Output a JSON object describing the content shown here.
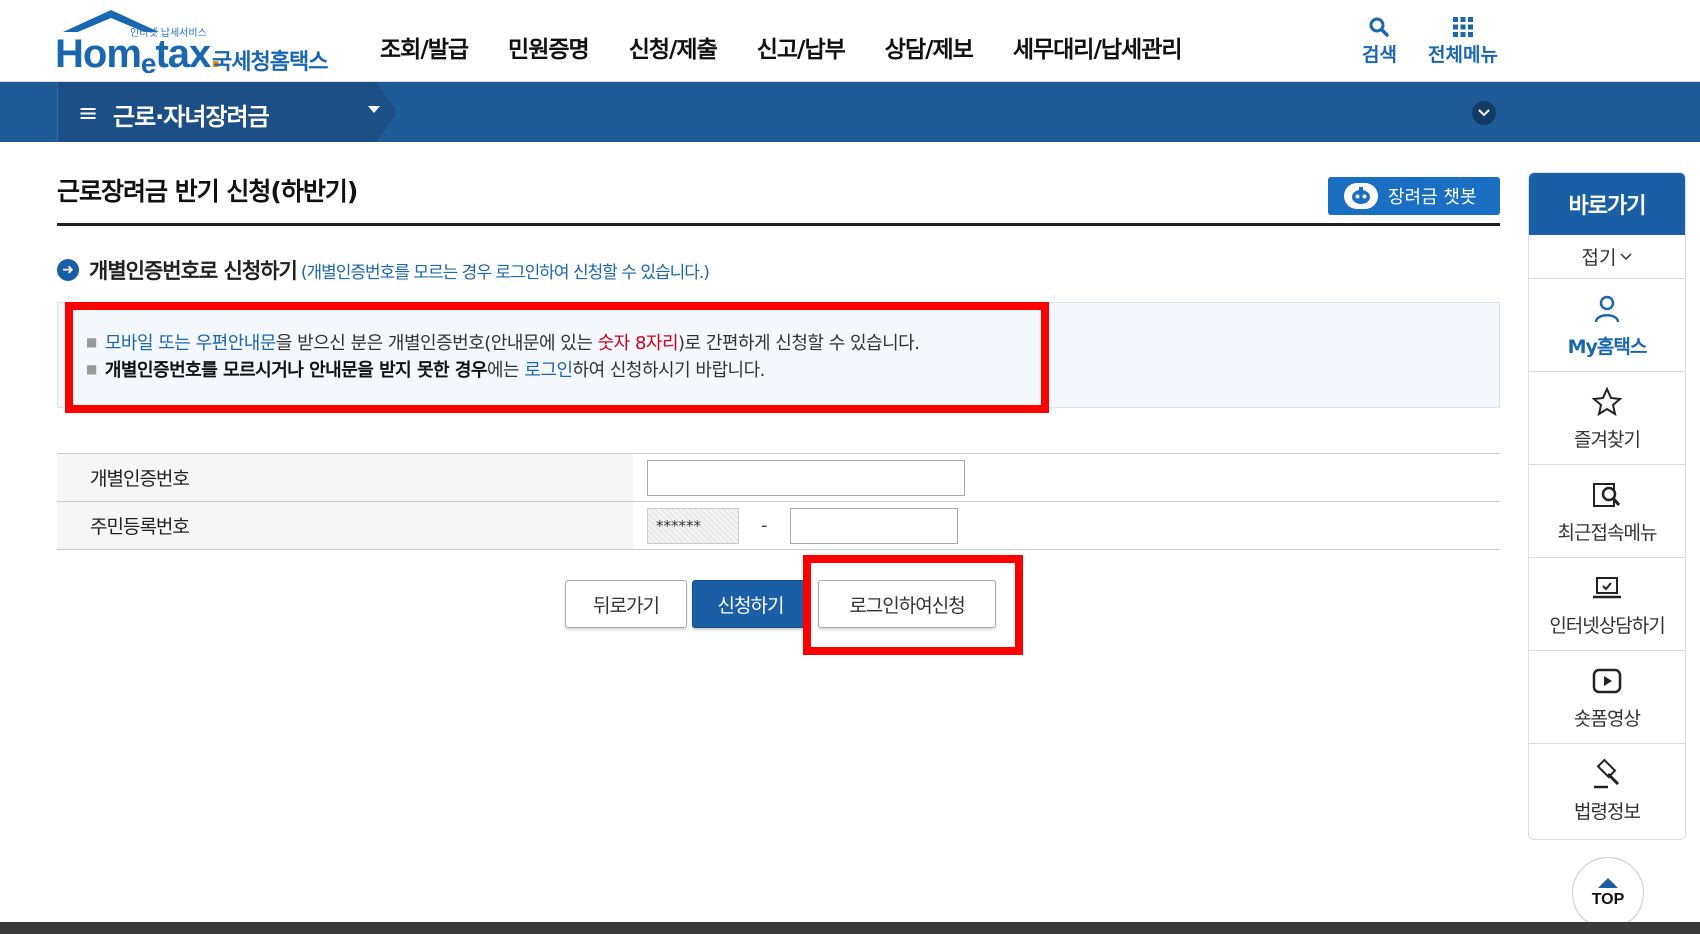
{
  "header": {
    "logo_tagline": "인터넷 납세서비스",
    "logo_word_a": "Hom",
    "logo_word_e": "e",
    "logo_word_b": "tax",
    "logo_dot": ".",
    "logo_kr": "국세청홈택스",
    "gnb": [
      "조회/발급",
      "민원증명",
      "신청/제출",
      "신고/납부",
      "상담/제보",
      "세무대리/납세관리"
    ],
    "search_label": "검색",
    "allmenu_label": "전체메뉴"
  },
  "subbar": {
    "menu_label": "근로·자녀장려금"
  },
  "content": {
    "page_title": "근로장려금 반기 신청(하반기)",
    "chatbot_label": "장려금 챗봇",
    "sub_heading": "개별인증번호로 신청하기",
    "sub_heading_note": "(개별인증번호를 모르는 경우 로그인하여 신청할 수 있습니다.)",
    "info_line1": {
      "p1": "모바일 또는 우편안내문",
      "p2": "을 받으신 분은 개별인증번호(안내문에 있는 ",
      "p3": "숫자 8자리",
      "p4": ")로 간편하게 신청할 수 있습니다."
    },
    "info_line2": {
      "p1": "개별인증번호를 모르시거나 안내문을 받지 못한 경우",
      "p2": "에는 ",
      "p3": "로그인",
      "p4": "하여 신청하시기 바랍니다."
    },
    "form": {
      "cert_label": "개별인증번호",
      "cert_value": "",
      "rrn_label": "주민등록번호",
      "rrn_front_mask": "******",
      "rrn_dash": "-",
      "rrn_back_value": ""
    },
    "buttons": {
      "back": "뒤로가기",
      "apply": "신청하기",
      "login_apply": "로그인하여신청"
    }
  },
  "quick_menu": {
    "title": "바로가기",
    "fold": "접기",
    "items": [
      {
        "label": "My홈택스",
        "icon": "person-icon"
      },
      {
        "label": "즐겨찾기",
        "icon": "star-icon"
      },
      {
        "label": "최근접속메뉴",
        "icon": "recent-search-icon"
      },
      {
        "label": "인터넷상담하기",
        "icon": "laptop-check-icon"
      },
      {
        "label": "숏폼영상",
        "icon": "play-icon"
      },
      {
        "label": "법령정보",
        "icon": "gavel-icon"
      }
    ],
    "top_label": "TOP"
  },
  "colors": {
    "brand_blue": "#1a5fa6",
    "highlight_red": "#ff0000"
  }
}
